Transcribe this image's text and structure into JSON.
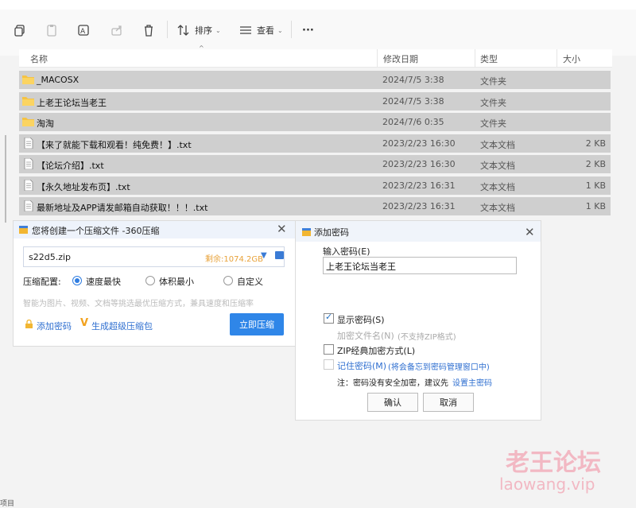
{
  "toolbar": {
    "sort_label": "排序",
    "view_label": "查看",
    "more_label": "···"
  },
  "columns": {
    "name": "名称",
    "date": "修改日期",
    "type": "类型",
    "size": "大小"
  },
  "files": [
    {
      "name": "_MACOSX",
      "date": "2024/7/5 3:38",
      "type": "文件夹",
      "size": "",
      "kind": "folder"
    },
    {
      "name": "上老王论坛当老王",
      "date": "2024/7/5 3:38",
      "type": "文件夹",
      "size": "",
      "kind": "folder"
    },
    {
      "name": "淘淘",
      "date": "2024/7/6 0:35",
      "type": "文件夹",
      "size": "",
      "kind": "folder"
    },
    {
      "name": "【来了就能下载和观看！纯免费！】.txt",
      "date": "2023/2/23 16:30",
      "type": "文本文档",
      "size": "2 KB",
      "kind": "file"
    },
    {
      "name": "【论坛介绍】.txt",
      "date": "2023/2/23 16:30",
      "type": "文本文档",
      "size": "2 KB",
      "kind": "file"
    },
    {
      "name": "【永久地址发布页】.txt",
      "date": "2023/2/23 16:31",
      "type": "文本文档",
      "size": "1 KB",
      "kind": "file"
    },
    {
      "name": "最新地址及APP请发邮箱自动获取！！！.txt",
      "date": "2023/2/23 16:31",
      "type": "文本文档",
      "size": "1 KB",
      "kind": "file"
    }
  ],
  "compress_dialog": {
    "title": "您将创建一个压缩文件 -360压缩",
    "filename": "s22d5.zip",
    "free_space": "剩余:1074.2GB",
    "config_label": "压缩配置:",
    "options": [
      "速度最快",
      "体积最小",
      "自定义"
    ],
    "selected_option": "速度最快",
    "hint": "智能为图片、视频、文档等挑选最优压缩方式，兼具速度和压缩率",
    "add_password": "添加密码",
    "super_package": "生成超级压缩包",
    "compress_button": "立即压缩"
  },
  "password_dialog": {
    "title": "添加密码",
    "input_label": "输入密码(E)",
    "password_value": "上老王论坛当老王",
    "show_password": "显示密码(S)",
    "show_password_checked": true,
    "encrypt_filename": "加密文件名(N)",
    "encrypt_note": "(不支持ZIP格式)",
    "zip_classic": "ZIP经典加密方式(L)",
    "remember": "记住密码(M)",
    "remember_note": "(将会备忘到密码管理窗口中)",
    "note_prefix": "注：密码没有安全加密，建议先",
    "note_link": "设置主密码",
    "ok": "确认",
    "cancel": "取消"
  },
  "watermark": {
    "cn": "老王论坛",
    "url": "laowang.vip"
  },
  "status_fragment": "项目"
}
